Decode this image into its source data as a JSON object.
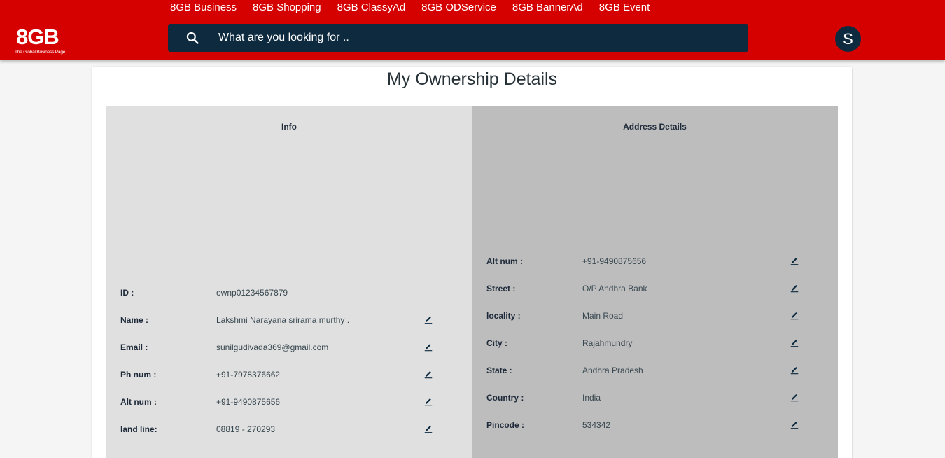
{
  "header": {
    "logo": {
      "text": "8GB",
      "tagline": "The Global Business Page"
    },
    "nav": [
      "8GB Business",
      "8GB Shopping",
      "8GB ClassyAd",
      "8GB ODService",
      "8GB BannerAd",
      "8GB Event"
    ],
    "search": {
      "placeholder": "What are you looking for ..",
      "value": ""
    },
    "avatar_initial": "S"
  },
  "page": {
    "title": "My Ownership Details",
    "info": {
      "heading": "Info",
      "rows": [
        {
          "label": "ID :",
          "value": "ownp01234567879",
          "editable": false
        },
        {
          "label": "Name :",
          "value": "Lakshmi Narayana srirama murthy .",
          "editable": true
        },
        {
          "label": "Email :",
          "value": "sunilgudivada369@gmail.com",
          "editable": true
        },
        {
          "label": "Ph num :",
          "value": "+91-7978376662",
          "editable": true
        },
        {
          "label": "Alt num :",
          "value": "+91-9490875656",
          "editable": true
        },
        {
          "label": "land line:",
          "value": "08819 - 270293",
          "editable": true
        }
      ]
    },
    "address": {
      "heading": "Address Details",
      "rows": [
        {
          "label": "Alt num :",
          "value": "+91-9490875656",
          "editable": true
        },
        {
          "label": "Street :",
          "value": "O/P Andhra Bank",
          "editable": true
        },
        {
          "label": "locality :",
          "value": "Main Road",
          "editable": true
        },
        {
          "label": "City :",
          "value": "Rajahmundry",
          "editable": true
        },
        {
          "label": "State :",
          "value": "Andhra Pradesh",
          "editable": true
        },
        {
          "label": "Country :",
          "value": "India",
          "editable": true
        },
        {
          "label": "Pincode :",
          "value": "534342",
          "editable": true
        }
      ]
    }
  },
  "colors": {
    "brand_red": "#d50000",
    "navy": "#0d2a3f",
    "info_panel": "#e0e0e0",
    "address_panel": "#bdbdbd"
  },
  "icons": {
    "search": "search-icon",
    "edit": "pencil-edit-icon"
  }
}
